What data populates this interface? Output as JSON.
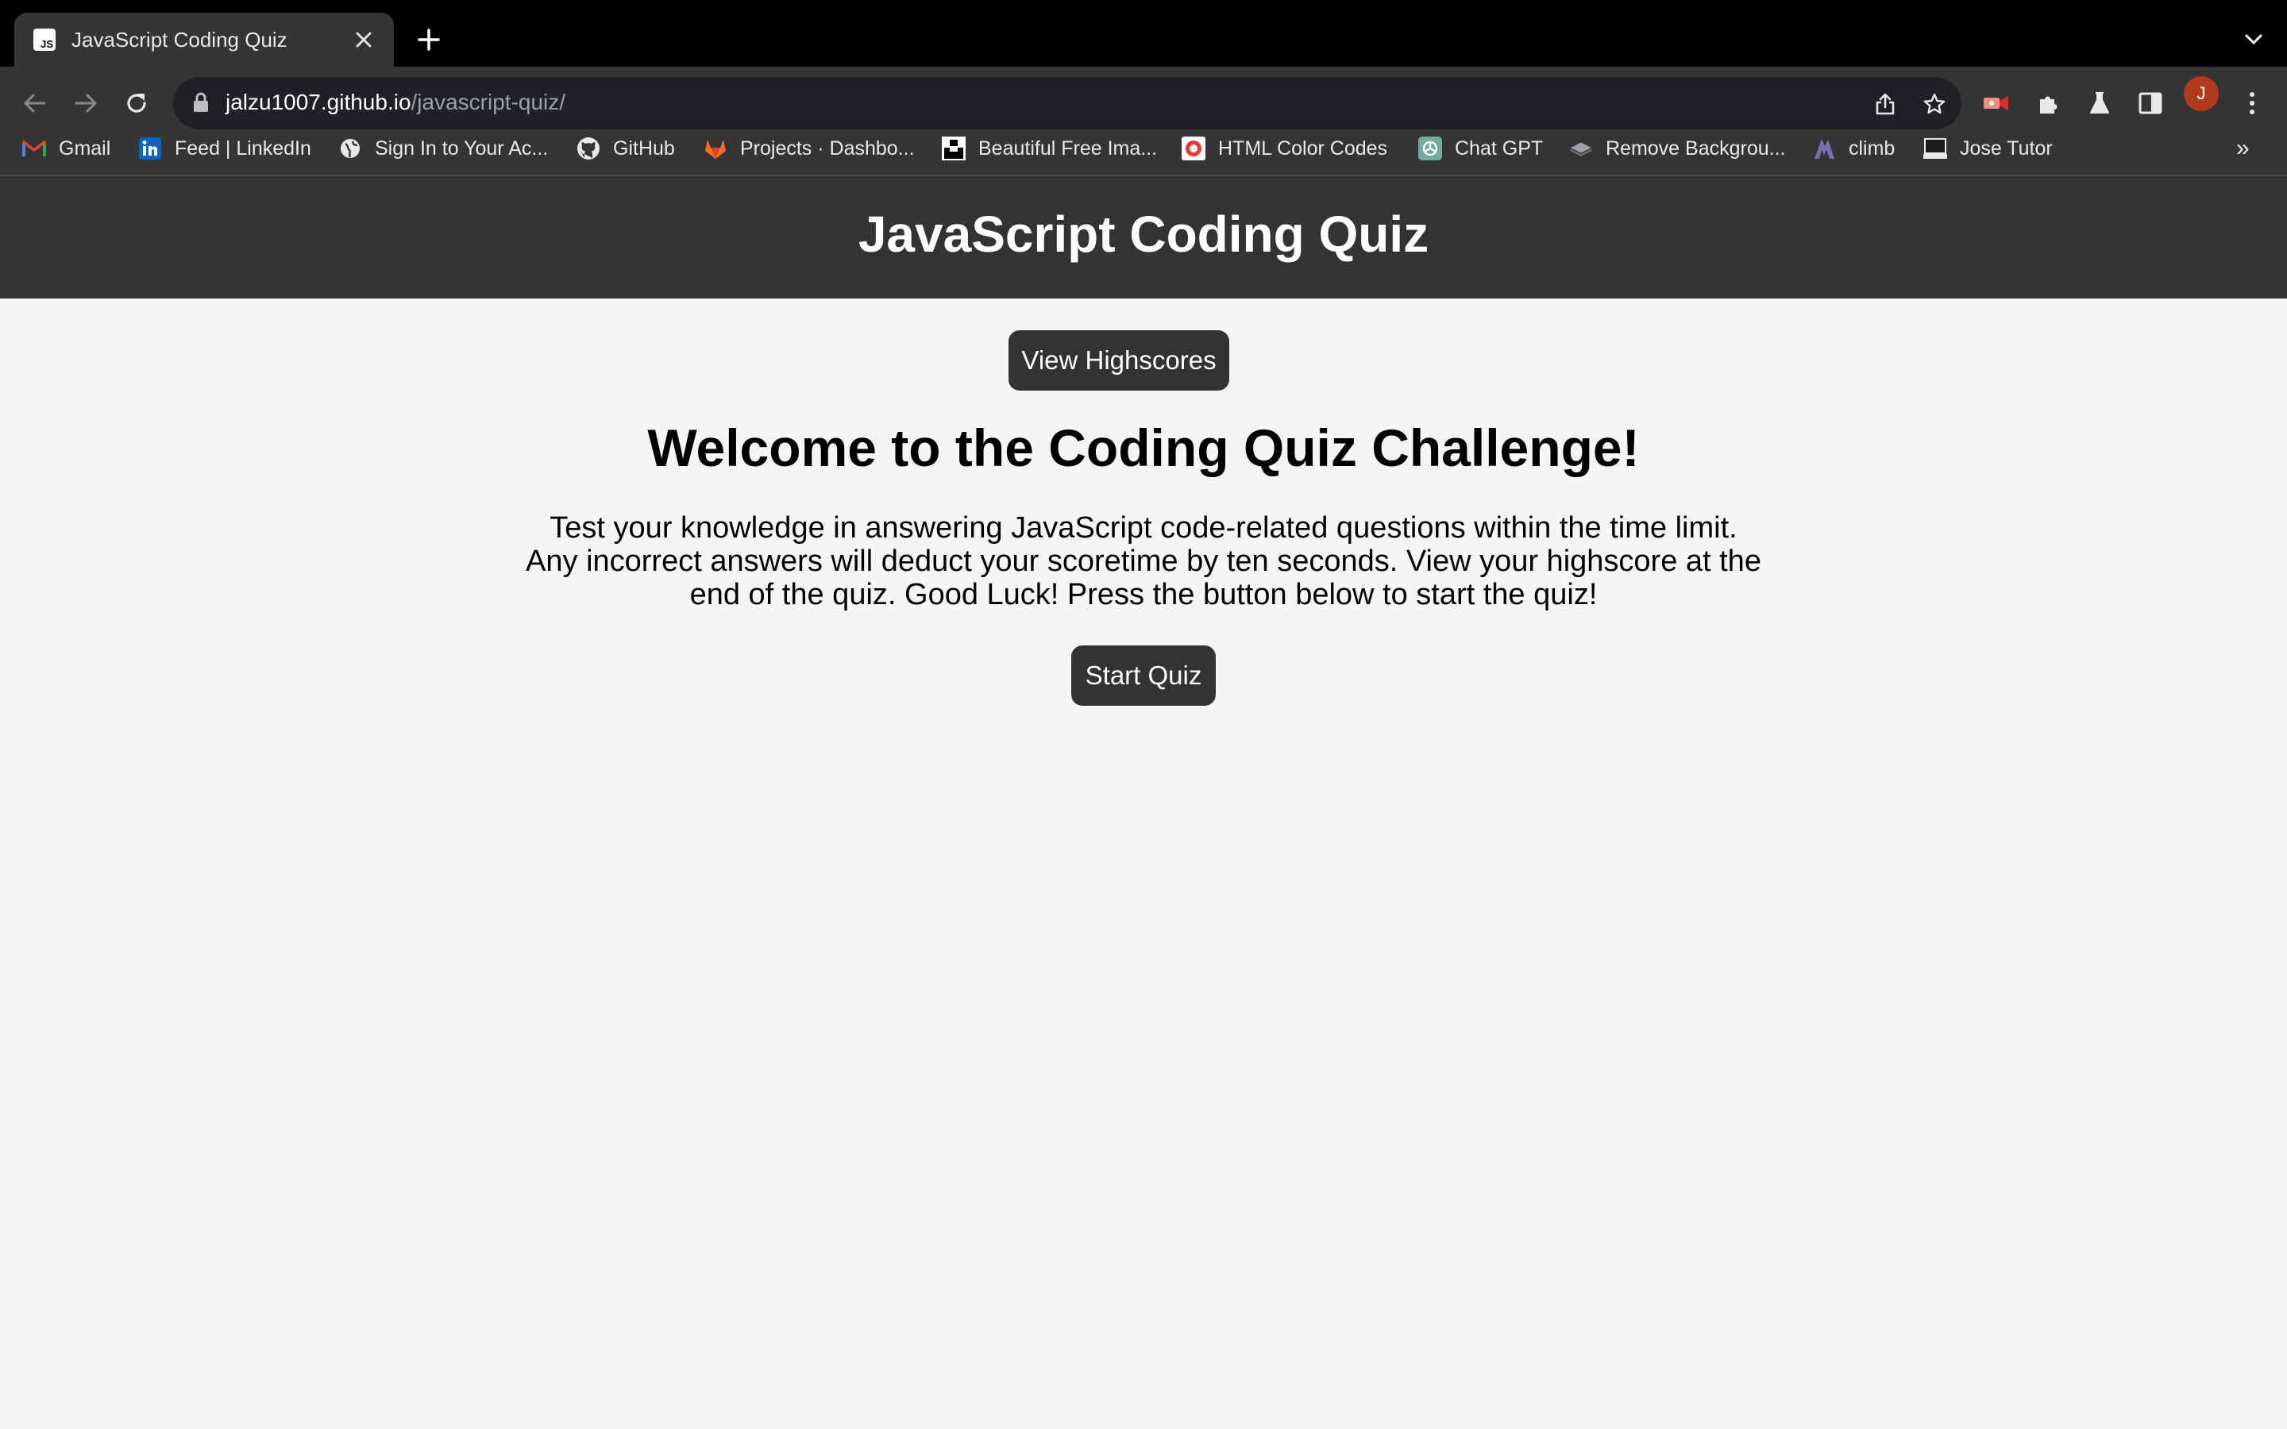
{
  "browser": {
    "tab_title": "JavaScript Coding Quiz",
    "tab_favicon_text": "JS",
    "url_host": "jalzu1007.github.io",
    "url_path": "/javascript-quiz/",
    "avatar_initial": "J",
    "bookmarks": [
      {
        "label": "Gmail",
        "icon": "gmail-icon"
      },
      {
        "label": "Feed | LinkedIn",
        "icon": "linkedin-icon"
      },
      {
        "label": "Sign In to Your Ac...",
        "icon": "globe-icon"
      },
      {
        "label": "GitHub",
        "icon": "github-icon"
      },
      {
        "label": "Projects · Dashbo...",
        "icon": "gitlab-icon"
      },
      {
        "label": "Beautiful Free Ima...",
        "icon": "unsplash-icon"
      },
      {
        "label": "HTML Color Codes",
        "icon": "color-codes-icon"
      },
      {
        "label": "Chat GPT",
        "icon": "chatgpt-icon"
      },
      {
        "label": "Remove Backgrou...",
        "icon": "remove-bg-icon"
      },
      {
        "label": "climb",
        "icon": "climb-icon"
      },
      {
        "label": "Jose Tutor",
        "icon": "tutor-icon"
      }
    ],
    "bookmarks_overflow": "»"
  },
  "page": {
    "header_title": "JavaScript Coding Quiz",
    "highscores_button": "View Highscores",
    "welcome_heading": "Welcome to the Coding Quiz Challenge!",
    "intro_text": "Test your knowledge in answering JavaScript code-related questions within the time limit. Any incorrect answers will deduct your scoretime by ten seconds. View your highscore at the end of the quiz. Good Luck! Press the button below to start the quiz!",
    "start_button": "Start Quiz"
  },
  "colors": {
    "header_bg": "#333333",
    "page_bg": "#f5f5f5",
    "button_bg": "#333333",
    "chrome_bg": "#353535"
  }
}
